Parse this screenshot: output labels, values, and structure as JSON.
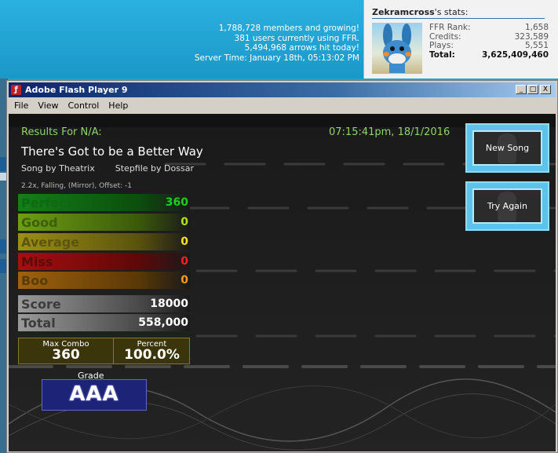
{
  "site_stats": {
    "members": "1,788,728 members and growing!",
    "users_online": "381 users currently using FFR.",
    "arrows_hit": "5,494,968 arrows hit today!",
    "server_time": "Server Time: January 18th, 05:13:02 PM"
  },
  "user_panel": {
    "username": "Zekramcross",
    "title_suffix": "'s stats:",
    "stats": [
      {
        "label": "FFR Rank:",
        "value": "1,658"
      },
      {
        "label": "Credits:",
        "value": "323,589"
      },
      {
        "label": "Plays:",
        "value": "5,551"
      },
      {
        "label": "Total:",
        "value": "3,625,409,460"
      }
    ]
  },
  "window": {
    "title": "Adobe Flash Player 9",
    "icon": "flash-icon",
    "controls": {
      "minimize": "_",
      "maximize": "□",
      "close": "X"
    },
    "menu": [
      "File",
      "View",
      "Control",
      "Help"
    ]
  },
  "results": {
    "header": "Results For N/A:",
    "timestamp": "07:15:41pm, 18/1/2016",
    "song_title": "There's Got to be a Better Way",
    "song_by": "Song by Theatrix",
    "stepfile_by": "Stepfile by Dossar",
    "mods": "2.2x, Falling, (Mirror), Offset: -1",
    "judges": [
      {
        "label": "Perfect",
        "value": "360",
        "label_color": "#0e6a12",
        "value_color": "#22cc22",
        "bar": "#147f18"
      },
      {
        "label": "Good",
        "value": "0",
        "label_color": "#3d5f0c",
        "value_color": "#b6e21a",
        "bar": "#6e9e12"
      },
      {
        "label": "Average",
        "value": "0",
        "label_color": "#5c5510",
        "value_color": "#f2e51a",
        "bar": "#9c8f15"
      },
      {
        "label": "Miss",
        "value": "0",
        "label_color": "#5a0c0c",
        "value_color": "#ff2020",
        "bar": "#a80e0e"
      },
      {
        "label": "Boo",
        "value": "0",
        "label_color": "#5a3a08",
        "value_color": "#ff9a1a",
        "bar": "#9e620c"
      }
    ],
    "score_label": "Score",
    "score_value": "18000",
    "total_label": "Total",
    "total_value": "558,000",
    "max_combo_label": "Max Combo",
    "max_combo_value": "360",
    "percent_label": "Percent",
    "percent_value": "100.0%",
    "grade_label": "Grade",
    "grade_value": "AAA",
    "new_song_label": "New Song",
    "try_again_label": "Try Again"
  }
}
